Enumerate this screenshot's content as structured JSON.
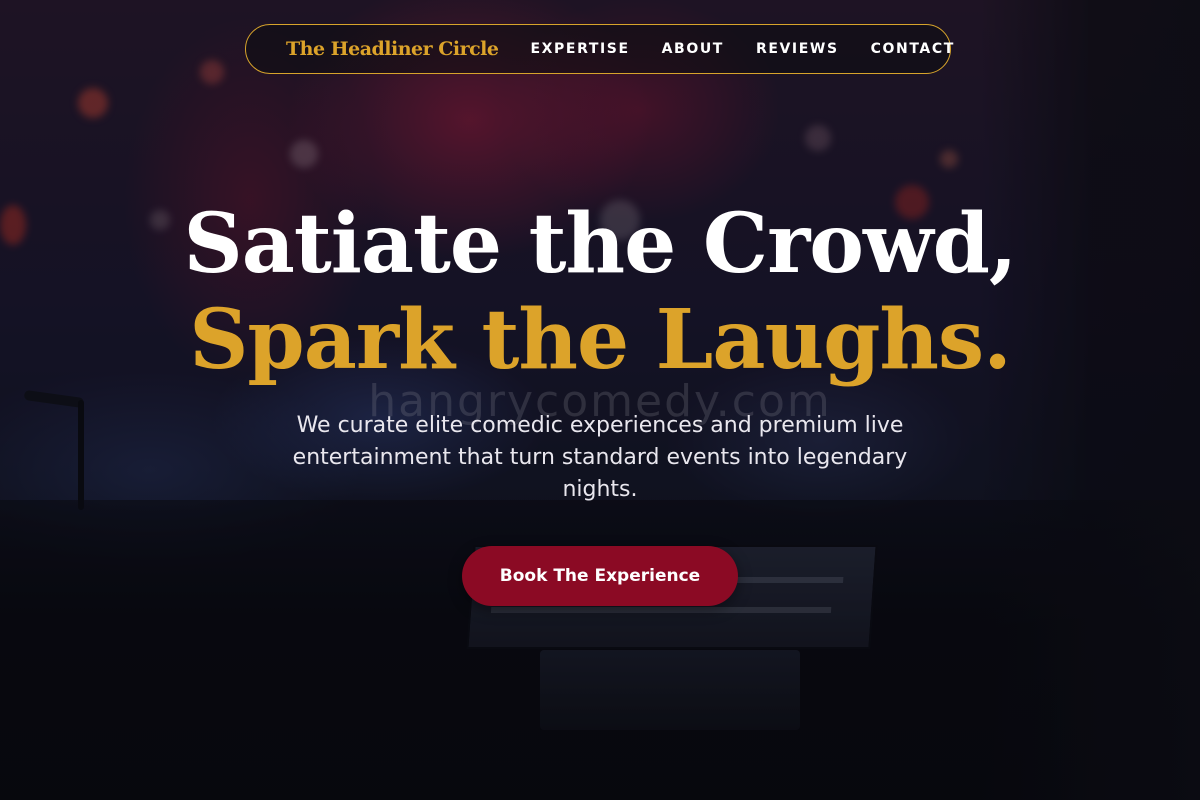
{
  "nav": {
    "brand": "The Headliner Circle",
    "links": [
      "EXPERTISE",
      "ABOUT",
      "REVIEWS",
      "CONTACT"
    ]
  },
  "hero": {
    "headline_line1": "Satiate the Crowd,",
    "headline_line2": "Spark the Laughs.",
    "subtext": "We curate elite comedic experiences and premium live entertainment that turn standard events into legendary nights.",
    "cta_label": "Book The Experience",
    "watermark": "hangrycomedy.com"
  },
  "colors": {
    "accent_gold": "#dca32a",
    "cta_red": "#8b0a24",
    "text_white": "#ffffff"
  }
}
